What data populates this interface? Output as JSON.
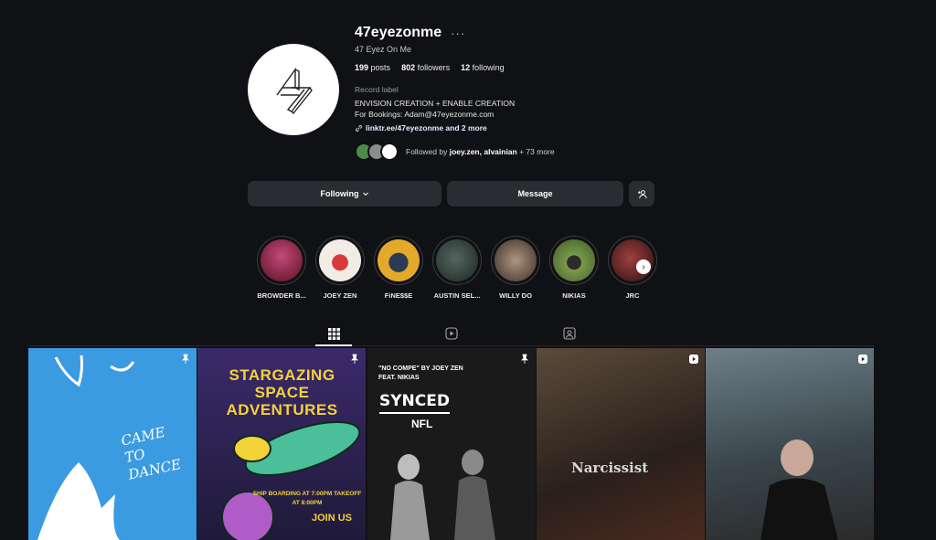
{
  "profile": {
    "username": "47eyezonme",
    "more_label": "···",
    "full_name": "47 Eyez On Me",
    "posts_count": "199",
    "posts_label": "posts",
    "followers_count": "802",
    "followers_label": "followers",
    "following_count": "12",
    "following_label": "following",
    "category": "Record label",
    "bio_line1": "ENVISION CREATION + ENABLE CREATION",
    "bio_line2": "For Bookings: Adam@47eyezonme.com",
    "link": "linktr.ee/47eyezonme and 2 more",
    "followed_by_prefix": "Followed by ",
    "followed_by_names": "joey.zen, alvainian",
    "followed_by_suffix": " + 73 more"
  },
  "actions": {
    "following_label": "Following",
    "message_label": "Message"
  },
  "highlights": [
    {
      "label": "BROWDER B...",
      "color": "#8a1a2e"
    },
    {
      "label": "JOEY ZEN",
      "color": "#f2ece6"
    },
    {
      "label": "FiNE$$E",
      "color": "#e3a92a"
    },
    {
      "label": "AUSTIN SEL...",
      "color": "#3b4a46"
    },
    {
      "label": "WILLY DO",
      "color": "#8a7565"
    },
    {
      "label": "NIKIAS",
      "color": "#5f7a3a"
    },
    {
      "label": "JRC",
      "color": "#6b2222"
    }
  ],
  "tabs": [
    "posts-grid",
    "reels",
    "tagged"
  ],
  "posts": [
    {
      "text": "CAME TO DANCE",
      "bg": "#3a9be0",
      "badge": "pin"
    },
    {
      "text": "STARGAZING SPACE ADVENTURES",
      "sub": "SHIP BOARDING AT 7:00PM TAKEOFF AT 8:00PM",
      "extra": "JOIN US",
      "bg": "#f1e7cf",
      "badge": "pin"
    },
    {
      "text": "SYNCED",
      "sub": "\"NO COMPE\" BY JOEY ZEN FEAT. NIKIAS",
      "extra": "NFL",
      "bg": "#1a1a1a",
      "badge": "pin"
    },
    {
      "text": "Narcissist",
      "bg": "#3a2e25",
      "badge": "reel"
    },
    {
      "text": "",
      "bg": "#5c6b74",
      "badge": "reel"
    }
  ],
  "colors": {
    "background": "#101114",
    "button": "#2a2c31"
  }
}
